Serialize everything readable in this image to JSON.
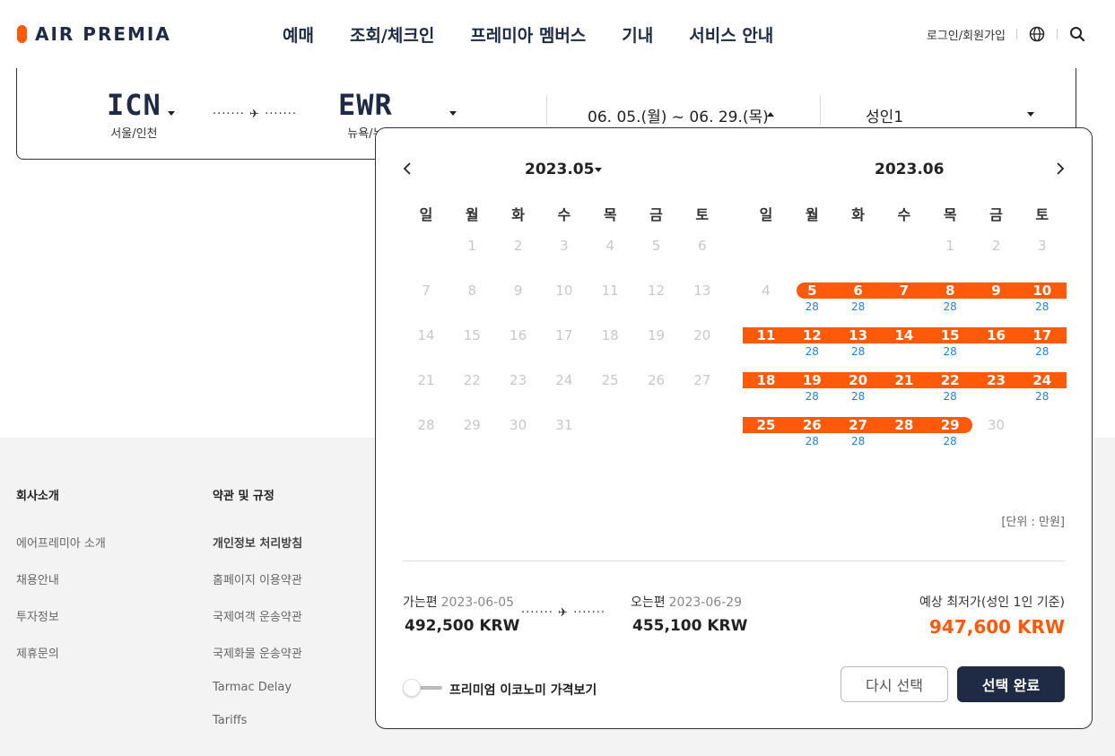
{
  "header": {
    "logo": "AIR PREMIA",
    "nav": [
      "예매",
      "조회/체크인",
      "프레미아 멤버스",
      "기내",
      "서비스 안내"
    ],
    "login": "로그인/회원가입"
  },
  "search": {
    "origin": {
      "code": "ICN",
      "city": "서울/인천"
    },
    "destination": {
      "code": "EWR",
      "city": "뉴욕/뉴"
    },
    "route_dots": "······· ✈ ·······",
    "dates": "06. 05.(월) ~ 06. 29.(목)",
    "passengers": "성인1"
  },
  "calendar": {
    "weekdays": [
      "일",
      "월",
      "화",
      "수",
      "목",
      "금",
      "토"
    ],
    "left": {
      "title": "2023.05",
      "first_weekday": 1,
      "days": 31
    },
    "right": {
      "title": "2023.06",
      "first_weekday": 4,
      "days": 30,
      "disabled_before": 5,
      "disabled_after": 29,
      "prices": {
        "5": "28",
        "6": "28",
        "8": "28",
        "10": "28",
        "12": "28",
        "13": "28",
        "15": "28",
        "17": "28",
        "19": "28",
        "20": "28",
        "22": "28",
        "24": "28",
        "26": "28",
        "27": "28",
        "29": "28"
      }
    },
    "unit": "[단위 : 만원]",
    "outbound": {
      "label": "가는편",
      "date": "2023-06-05",
      "price": "492,500 KRW"
    },
    "inbound": {
      "label": "오는편",
      "date": "2023-06-29",
      "price": "455,100 KRW"
    },
    "leg_dots": "······· ✈ ·······",
    "estimate_label": "예상 최저가(성인 1인 기준)",
    "estimate_price": "947,600 KRW",
    "toggle_label": "프리미엄 이코노미 가격보기",
    "reset_label": "다시 선택",
    "done_label": "선택 완료",
    "colors": {
      "accent": "#ff5a0a",
      "navy": "#1f2a44",
      "price": "#2a7fd4"
    }
  },
  "footer": {
    "col1": {
      "title": "회사소개",
      "links": [
        "에어프레미아 소개",
        "채용안내",
        "투자정보",
        "제휴문의"
      ]
    },
    "col2": {
      "title": "약관 및 규정",
      "links": [
        "개인정보 처리방침",
        "홈페이지 이용약관",
        "국제여객 운송약관",
        "국제화물 운송약관",
        "Tarmac Delay",
        "Tariffs"
      ]
    }
  }
}
